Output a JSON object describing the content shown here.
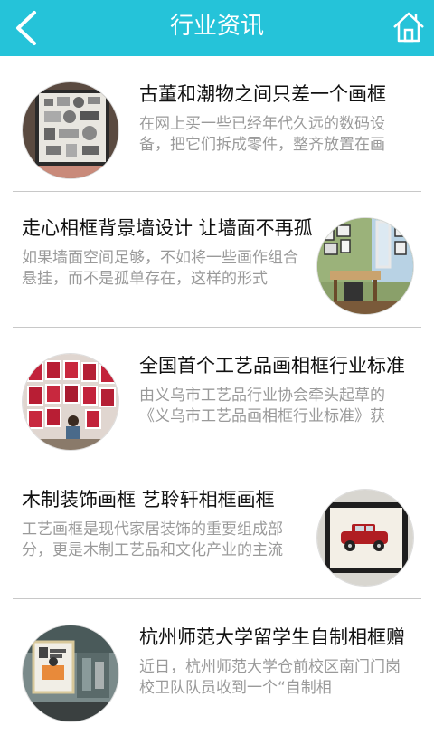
{
  "header": {
    "title": "行业资讯",
    "back_icon": "chevron-left-icon",
    "home_icon": "home-icon",
    "color": "#25c3d9"
  },
  "articles": [
    {
      "title": "古董和潮物之间只差一个画框",
      "summary": "在网上买一些已经年代久远的数码设备，把它们拆成零件，整齐放置在画",
      "image": "framed-electronics-photo"
    },
    {
      "title": "走心相框背景墙设计 让墙面不再孤",
      "summary": "如果墙面空间足够，不如将一些画作组合悬挂，而不是孤单存在，这样的形式",
      "image": "photo-wall-room-photo"
    },
    {
      "title": "全国首个工艺品画相框行业标准",
      "summary": "由义乌市工艺品行业协会牵头起草的《义乌市工艺品画相框行业标准》获",
      "image": "frame-shop-photo"
    },
    {
      "title": "木制装饰画框 艺聆轩相框画框",
      "summary": "工艺画框是现代家居装饰的重要组成部分，更是木制工艺品和文化产业的主流",
      "image": "framed-car-print-photo"
    },
    {
      "title": "杭州师范大学留学生自制相框赠",
      "summary": "近日，杭州师范大学仓前校区南门门岗校卫队队员收到一个“自制相",
      "image": "handmade-frame-photo"
    }
  ]
}
